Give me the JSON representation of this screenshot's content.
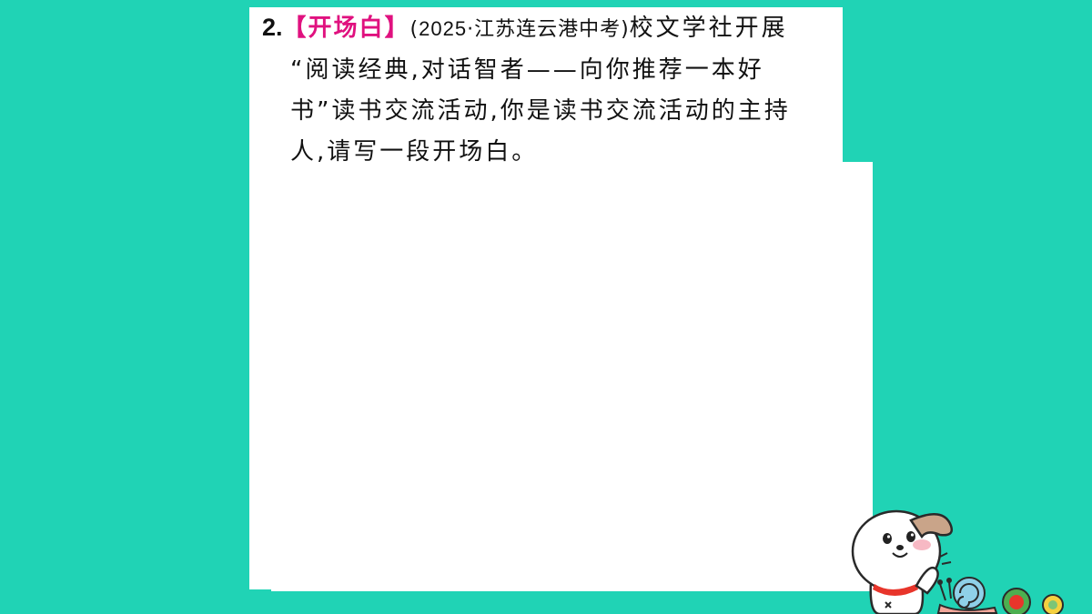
{
  "question": {
    "number": "2.",
    "tag": "【开场白】",
    "source_open": "(",
    "source_year": "2025",
    "source_rest": "·江苏连云港中考)",
    "line1_tail": "校文学社开展",
    "line2": "“阅读经典,对话智者——向你推荐一本好",
    "line3": "书”读书交流活动,你是读书交流活动的主持",
    "line4": "人,请写一段开场白。"
  },
  "colors": {
    "background": "#20d3b5",
    "paper": "#ffffff",
    "tag_accent": "#e0117f",
    "text": "#111111"
  },
  "decoration": {
    "icons": [
      "puppy-icon",
      "snail-icon",
      "round-candy-icon"
    ]
  }
}
